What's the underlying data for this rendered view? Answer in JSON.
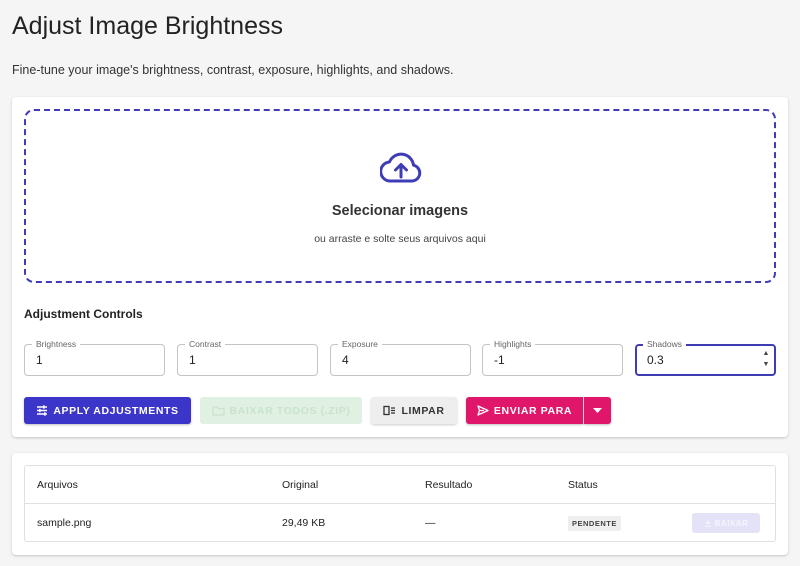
{
  "header": {
    "title": "Adjust Image Brightness",
    "subtitle": "Fine-tune your image's brightness, contrast, exposure, highlights, and shadows."
  },
  "dropzone": {
    "icon": "cloud-upload-icon",
    "title": "Selecionar imagens",
    "subtitle": "ou arraste e solte seus arquivos aqui"
  },
  "controls": {
    "title": "Adjustment Controls",
    "fields": [
      {
        "label": "Brightness",
        "value": "1"
      },
      {
        "label": "Contrast",
        "value": "1"
      },
      {
        "label": "Exposure",
        "value": "4"
      },
      {
        "label": "Highlights",
        "value": "-1"
      },
      {
        "label": "Shadows",
        "value": "0.3"
      }
    ]
  },
  "actions": {
    "apply": "APPLY ADJUSTMENTS",
    "download_all": "BAIXAR TODOS (.ZIP)",
    "clear": "LIMPAR",
    "send_to": "ENVIAR PARA"
  },
  "table": {
    "headers": [
      "Arquivos",
      "Original",
      "Resultado",
      "Status"
    ],
    "rows": [
      {
        "file": "sample.png",
        "original": "29,49 KB",
        "result": "—",
        "status": "PENDENTE",
        "action": "BAIXAR"
      }
    ]
  },
  "colors": {
    "primary": "#3b35c9",
    "accent": "#e0166a",
    "background": "#f5f5f5"
  }
}
